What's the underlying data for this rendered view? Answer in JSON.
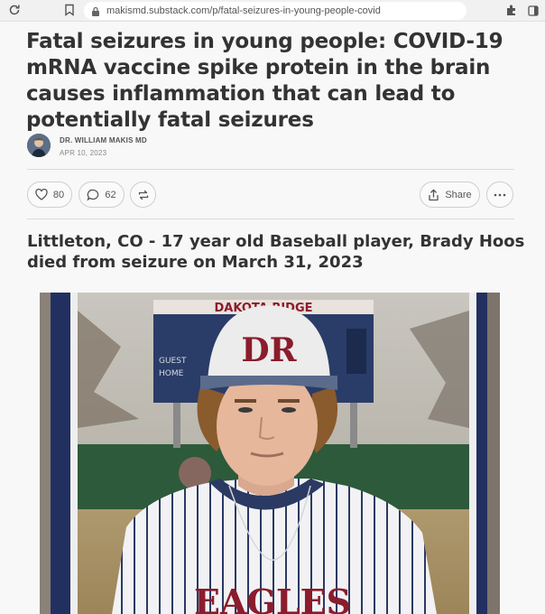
{
  "browser": {
    "url": "makismd.substack.com/p/fatal-seizures-in-young-people-covid"
  },
  "article": {
    "title": "Fatal seizures in young people: COVID-19 mRNA vaccine spike protein in the brain causes inflammation that can lead to potentially fatal seizures",
    "author": "DR. WILLIAM MAKIS MD",
    "date": "APR 10, 2023",
    "likes": "80",
    "comments": "62",
    "share_label": "Share",
    "subheading": "Littleton, CO - 17 year old Baseball player, Brady Hoos died from seizure on March 31, 2023"
  },
  "photo": {
    "cap_logo": "DR",
    "scoreboard_top": "DAKOTA RIDGE",
    "scoreboard_guest": "GUEST",
    "scoreboard_home": "HOME",
    "jersey_text": "EAGLES"
  },
  "colors": {
    "accent": "#333333",
    "cap_logo": "#8b1c2c",
    "scoreboard": "#2a3c68"
  }
}
